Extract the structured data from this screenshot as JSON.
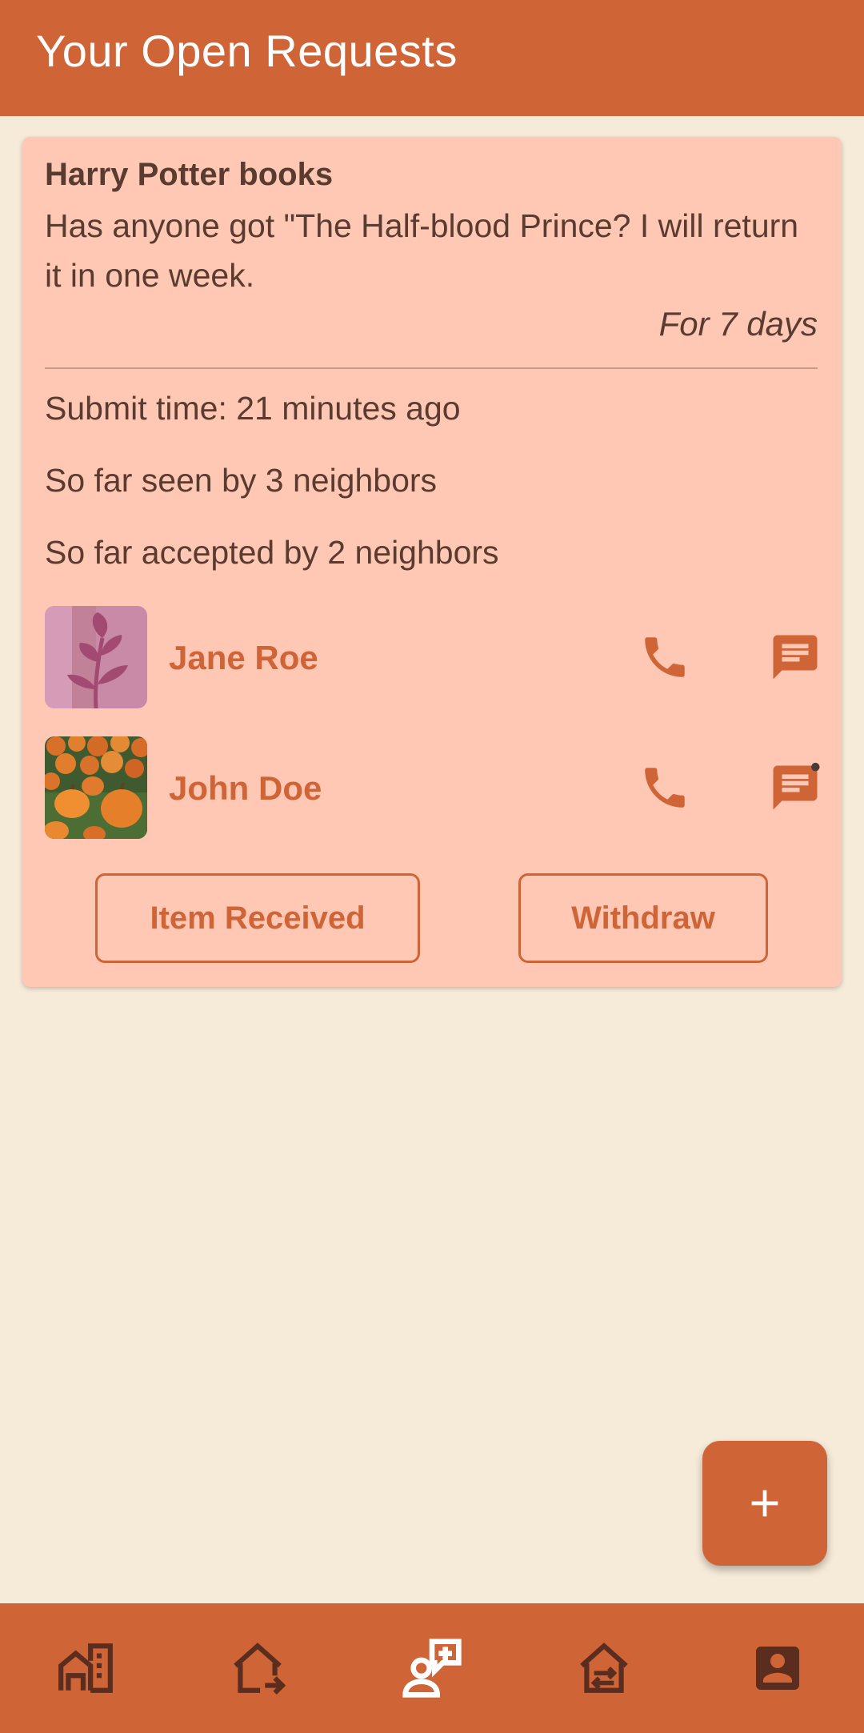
{
  "app_bar": {
    "title": "Your Open Requests"
  },
  "request": {
    "title": "Harry Potter books",
    "description": "Has anyone got \"The Half-blood Prince? I will return it in one week.",
    "duration": "For 7 days",
    "submit_time": "Submit time: 21 minutes ago",
    "seen_by": "So far seen by 3 neighbors",
    "accepted_by": "So far accepted by 2 neighbors",
    "neighbors": [
      {
        "name": "Jane Roe",
        "avatar": "plant-photo",
        "has_unread_message": false
      },
      {
        "name": "John Doe",
        "avatar": "pumpkins-photo",
        "has_unread_message": true
      }
    ],
    "actions": {
      "received_label": "Item Received",
      "withdraw_label": "Withdraw"
    }
  },
  "fab": {
    "icon": "plus-icon"
  },
  "bottom_nav": {
    "items": [
      {
        "icon": "neighborhood-icon",
        "active": false
      },
      {
        "icon": "home-outgoing-icon",
        "active": false
      },
      {
        "icon": "person-add-request-icon",
        "active": true
      },
      {
        "icon": "home-exchange-icon",
        "active": false
      },
      {
        "icon": "account-box-icon",
        "active": false
      }
    ]
  },
  "colors": {
    "primary": "#cf6437",
    "background": "#f6ead8",
    "card": "#ffc8b5",
    "text": "#5a3b30",
    "nav_icon": "#5b2d1f",
    "nav_icon_active": "#ffffff"
  }
}
